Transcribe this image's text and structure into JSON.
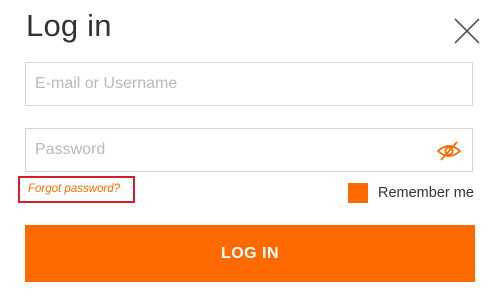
{
  "dialog": {
    "title": "Log in",
    "close_icon": "close-icon"
  },
  "form": {
    "email": {
      "placeholder": "E-mail or Username",
      "value": ""
    },
    "password": {
      "placeholder": "Password",
      "value": "",
      "toggle_icon": "eye-slash-icon"
    },
    "forgot_password_label": "Forgot password?",
    "remember_me": {
      "label": "Remember me",
      "checked": true
    },
    "submit_label": "LOG IN"
  },
  "colors": {
    "accent": "#ff6a00",
    "highlight_border": "#d0202a",
    "text": "#333333",
    "placeholder": "#b9b9b9",
    "border": "#d4d4d4"
  }
}
